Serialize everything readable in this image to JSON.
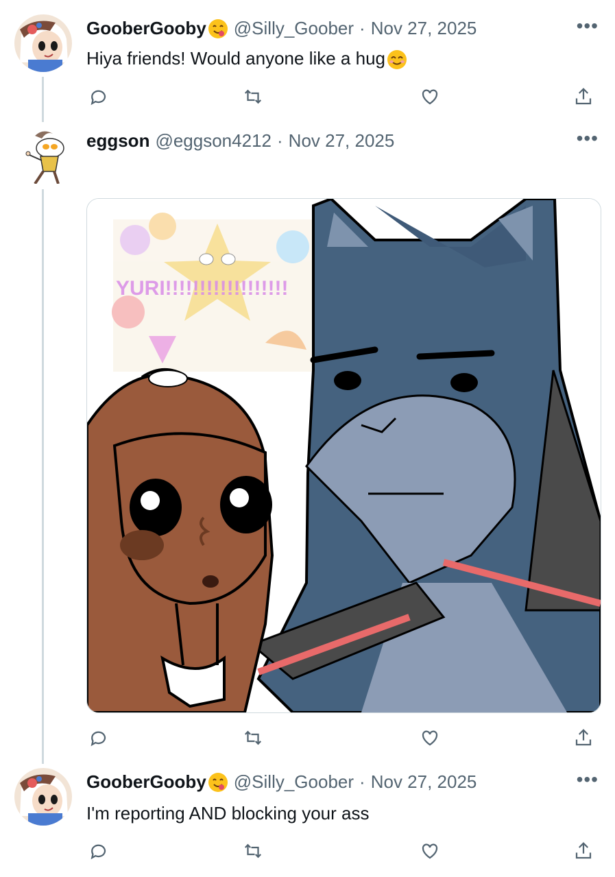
{
  "tweets": [
    {
      "display_name": "GooberGooby",
      "handle": "@Silly_Goober",
      "date": "Nov 27, 2025",
      "text": "Hiya friends! Would anyone like a hug",
      "has_name_emoji": true,
      "has_text_emoji": true
    },
    {
      "display_name": "eggson",
      "handle": "@eggson4212",
      "date": "Nov 27, 2025",
      "text": "",
      "media": {
        "overlay_text": "YURI!!!!!!!!!!!!!!!!!!"
      }
    },
    {
      "display_name": "GooberGooby",
      "handle": "@Silly_Goober",
      "date": "Nov 27, 2025",
      "text": "I'm reporting AND blocking your ass",
      "has_name_emoji": true
    }
  ],
  "separator": "·",
  "more_glyph": "•••",
  "icons": [
    "reply-icon",
    "retweet-icon",
    "like-icon",
    "share-icon",
    "more-icon"
  ],
  "colors": {
    "text": "#0f1419",
    "secondary": "#536471",
    "thread_line": "#cfd9de"
  }
}
